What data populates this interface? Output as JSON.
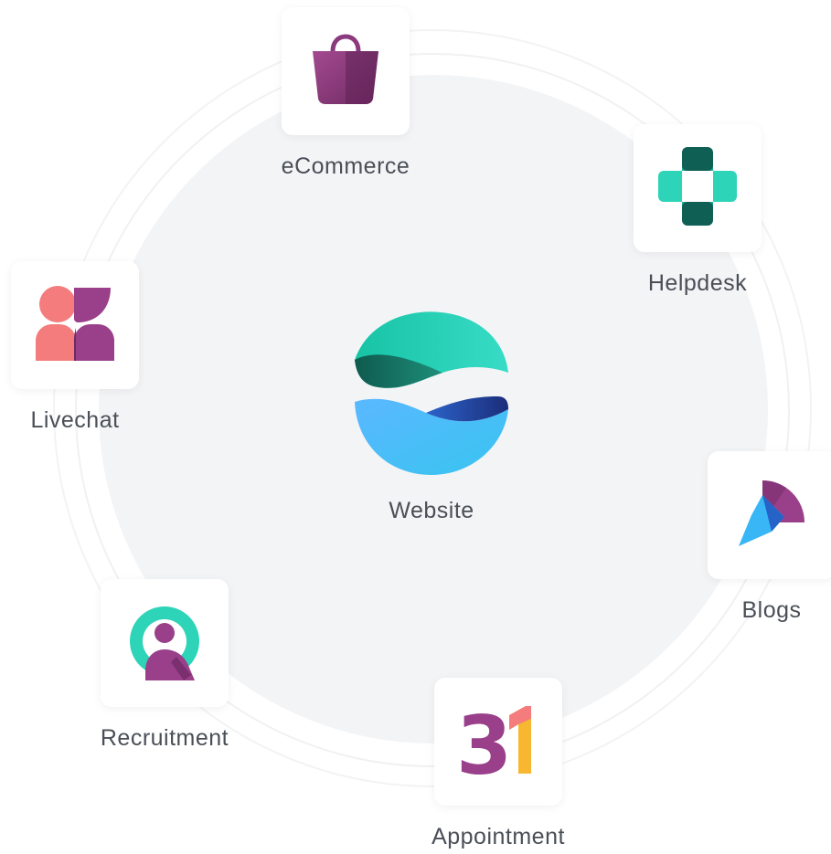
{
  "center": {
    "label": "Website",
    "icon": "website-globe-icon"
  },
  "apps": [
    {
      "label": "eCommerce",
      "icon": "shopping-bag-icon"
    },
    {
      "label": "Helpdesk",
      "icon": "helpdesk-cross-icon"
    },
    {
      "label": "Livechat",
      "icon": "livechat-people-icon"
    },
    {
      "label": "Blogs",
      "icon": "blogs-feather-icon"
    },
    {
      "label": "Recruitment",
      "icon": "recruitment-q-icon"
    },
    {
      "label": "Appointment",
      "icon": "appointment-calendar-icon",
      "glyph_text": "31"
    }
  ],
  "colors": {
    "teal": "#2dd4bf",
    "dark_teal": "#0f5f55",
    "blue": "#38bdf8",
    "navy": "#1e3a8a",
    "purple": "#8b3a7e",
    "coral": "#f47c7c",
    "amber": "#f7b731",
    "disc_bg": "#f3f4f6",
    "label_text": "#4a4f57"
  }
}
